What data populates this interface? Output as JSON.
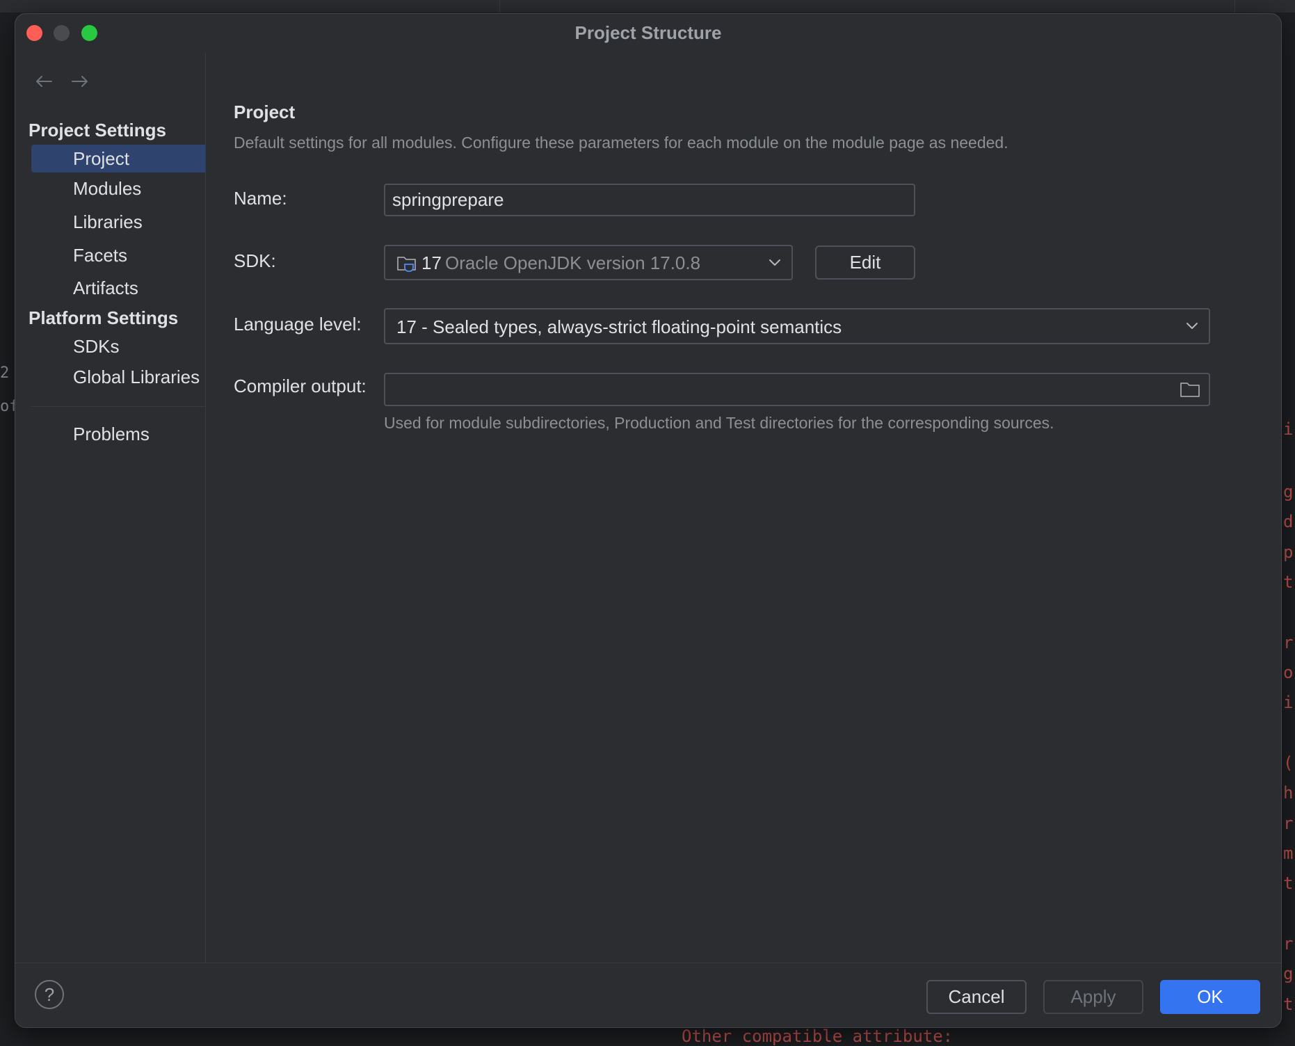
{
  "window": {
    "title": "Project Structure"
  },
  "sidebar": {
    "back_icon": "arrow-left-icon",
    "forward_icon": "arrow-right-icon",
    "project_settings_header": "Project Settings",
    "project_items": [
      {
        "label": "Project",
        "selected": true
      },
      {
        "label": "Modules"
      },
      {
        "label": "Libraries"
      },
      {
        "label": "Facets"
      },
      {
        "label": "Artifacts"
      }
    ],
    "platform_settings_header": "Platform Settings",
    "platform_items": [
      {
        "label": "SDKs"
      },
      {
        "label": "Global Libraries"
      }
    ],
    "problems_label": "Problems"
  },
  "main": {
    "title": "Project",
    "description": "Default settings for all modules. Configure these parameters for each module on the module page as needed.",
    "name": {
      "label": "Name:",
      "value": "springprepare"
    },
    "sdk": {
      "label": "SDK:",
      "version": "17",
      "detail": "Oracle OpenJDK version 17.0.8",
      "edit_label": "Edit"
    },
    "language_level": {
      "label": "Language level:",
      "value": "17 - Sealed types, always-strict floating-point semantics"
    },
    "compiler_output": {
      "label": "Compiler output:",
      "value": "",
      "hint": "Used for module subdirectories, Production and Test directories for the corresponding sources."
    }
  },
  "footer": {
    "help_label": "?",
    "cancel_label": "Cancel",
    "apply_label": "Apply",
    "ok_label": "OK"
  },
  "background": {
    "bottom_code": "Other compatible attribute:",
    "right_fragments": [
      "i",
      "g",
      "d",
      "p",
      "t",
      "r",
      "o",
      "i",
      "(",
      "h",
      "r",
      "m",
      "t",
      "r",
      "g",
      "t"
    ],
    "left_fragments": [
      "2",
      "of"
    ]
  },
  "colors": {
    "accent": "#3574f0",
    "selection": "#2e436e",
    "dialog_bg": "#2b2d30",
    "close": "#ff5f57",
    "maximize": "#28c840"
  }
}
